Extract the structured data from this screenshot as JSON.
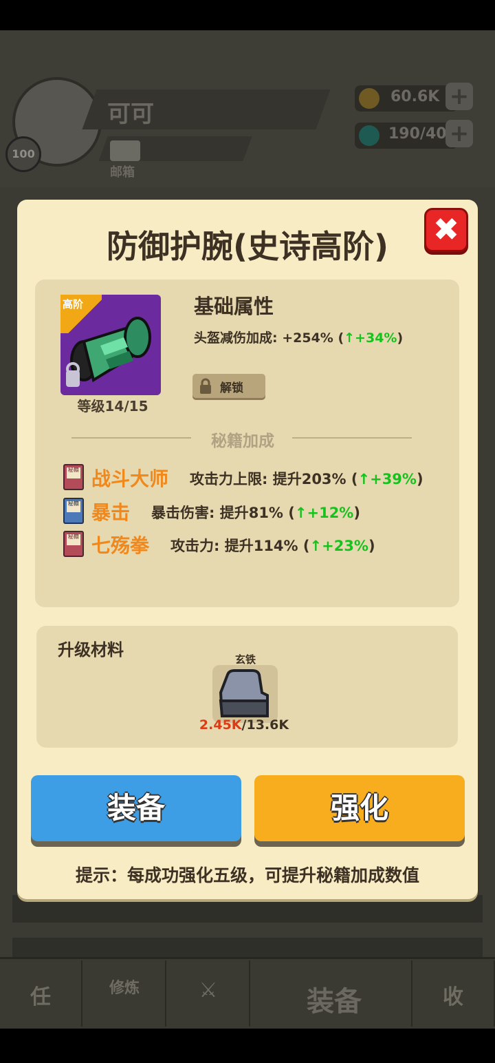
{
  "background": {
    "player_level": "100",
    "player_name": "可可",
    "mailbox_label": "邮箱",
    "gold": "60.6K",
    "energy": "190/40",
    "nav_task_glyph": "任",
    "nav_train_glyph": "修炼",
    "nav_equip_label": "装备",
    "nav_store_glyph": "收"
  },
  "modal": {
    "title": "防御护腕(史诗高阶)",
    "item": {
      "tier_badge": "高阶",
      "level": "等级14/15"
    },
    "base": {
      "title": "基础属性",
      "stat_text": "头盔减伤加成: +254% (",
      "stat_bonus": "↑+34%",
      "stat_close": ")",
      "unlock_label": "解锁"
    },
    "secret": {
      "title": "秘籍加成",
      "book_tag": "秘籍",
      "skills": [
        {
          "name": "战斗大师",
          "stat": "攻击力上限: 提升203% (",
          "bonus": "↑+39%",
          "close": ")",
          "book_color": "#b44b58"
        },
        {
          "name": "暴击",
          "stat": "暴击伤害: 提升81% (",
          "bonus": "↑+12%",
          "close": ")",
          "book_color": "#4e79b8"
        },
        {
          "name": "七殇拳",
          "stat": "攻击力: 提升114% (",
          "bonus": "↑+23%",
          "close": ")",
          "book_color": "#b44b58"
        }
      ]
    },
    "materials": {
      "title": "升级材料",
      "item_name": "玄铁",
      "have": "2.45K",
      "need": "/13.6K"
    },
    "buttons": {
      "equip": "装备",
      "upgrade": "强化"
    },
    "hint": "提示：每成功强化五级，可提升秘籍加成数值"
  }
}
